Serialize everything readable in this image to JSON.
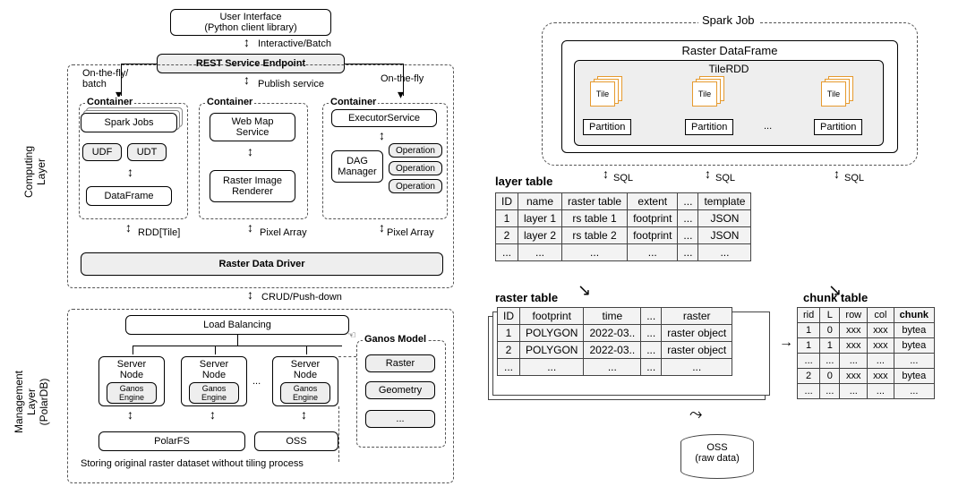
{
  "left": {
    "ui_title_l1": "User Interface",
    "ui_title_l2": "(Python client library)",
    "interactive_batch": "Interactive/Batch",
    "rest_endpoint": "REST Service Endpoint",
    "on_the_fly_batch": "On-the-fly/\nbatch",
    "on_the_fly": "On-the-fly",
    "publish_service": "Publish service",
    "computing_layer": "Computing\nLayer",
    "container": "Container",
    "spark_jobs": "Spark Jobs",
    "udf": "UDF",
    "udt": "UDT",
    "dataframe": "DataFrame",
    "web_map_service": "Web Map\nService",
    "raster_image_renderer": "Raster Image\nRenderer",
    "executor_service": "ExecutorService",
    "dag_manager": "DAG\nManager",
    "operation": "Operation",
    "rdd_tile": "RDD[Tile]",
    "pixel_array": "Pixel Array",
    "raster_data_driver": "Raster Data Driver",
    "crud_pushdown": "CRUD/Push-down",
    "management_layer": "Management\nLayer\n(PolarDB)",
    "load_balancing": "Load Balancing",
    "server_node": "Server\nNode",
    "ganos_engine": "Ganos\nEngine",
    "polarfs": "PolarFS",
    "oss": "OSS",
    "ganos_model": "Ganos Model",
    "raster": "Raster",
    "geometry": "Geometry",
    "ellipsis": "...",
    "storing_note": "Storing original raster dataset without tiling process"
  },
  "right": {
    "spark_job": "Spark Job",
    "raster_dataframe": "Raster DataFrame",
    "tile_rdd": "TileRDD",
    "tile": "Tile",
    "partition": "Partition",
    "ellipsis": "...",
    "sql": "SQL",
    "layer_table_title": "layer table",
    "layer_table": {
      "headers": [
        "ID",
        "name",
        "raster table",
        "extent",
        "...",
        "template"
      ],
      "rows": [
        [
          "1",
          "layer 1",
          "rs table 1",
          "footprint",
          "...",
          "JSON"
        ],
        [
          "2",
          "layer 2",
          "rs table 2",
          "footprint",
          "...",
          "JSON"
        ],
        [
          "...",
          "...",
          "...",
          "...",
          "...",
          "..."
        ]
      ]
    },
    "raster_table_title": "raster table",
    "raster_table": {
      "headers": [
        "ID",
        "footprint",
        "time",
        "...",
        "raster"
      ],
      "rows": [
        [
          "1",
          "POLYGON",
          "2022-03..",
          "...",
          "raster object"
        ],
        [
          "2",
          "POLYGON",
          "2022-03..",
          "...",
          "raster object"
        ],
        [
          "...",
          "...",
          "...",
          "...",
          "..."
        ]
      ]
    },
    "chunk_table_title": "chunk table",
    "chunk_table": {
      "headers": [
        "rid",
        "L",
        "row",
        "col",
        "chunk"
      ],
      "rows": [
        [
          "1",
          "0",
          "xxx",
          "xxx",
          "bytea"
        ],
        [
          "1",
          "1",
          "xxx",
          "xxx",
          "bytea"
        ],
        [
          "...",
          "...",
          "...",
          "...",
          "..."
        ],
        [
          "2",
          "0",
          "xxx",
          "xxx",
          "bytea"
        ],
        [
          "...",
          "...",
          "...",
          "...",
          "..."
        ]
      ]
    },
    "oss_raw": "OSS\n(raw data)"
  }
}
